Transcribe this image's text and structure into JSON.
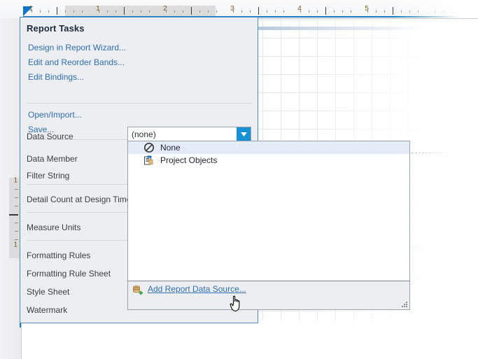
{
  "window": {
    "title": "Report Tasks"
  },
  "ruler": {
    "horizontal": {
      "unit_labels": [
        "1",
        "1",
        "2",
        "3",
        "4",
        "5"
      ],
      "marker_icon": "ruler-origin-marker"
    },
    "vertical": {
      "unit_labels": [
        "1",
        "1"
      ]
    }
  },
  "tasks_panel": {
    "title": "Report Tasks",
    "links": [
      {
        "label": "Design in Report Wizard...",
        "name": "design-in-report-wizard-link"
      },
      {
        "label": "Edit and Reorder Bands...",
        "name": "edit-and-reorder-bands-link"
      },
      {
        "label": "Edit Bindings...",
        "name": "edit-bindings-link"
      },
      {
        "label": "Open/Import...",
        "name": "open-import-link"
      },
      {
        "label": "Save...",
        "name": "save-link"
      }
    ],
    "properties": [
      {
        "label": "Data Source",
        "name": "property-data-source"
      },
      {
        "label": "Data Member",
        "name": "property-data-member"
      },
      {
        "label": "Filter String",
        "name": "property-filter-string"
      },
      {
        "label": "Detail Count at Design Time",
        "name": "property-detail-count-at-design-time"
      },
      {
        "label": "Measure Units",
        "name": "property-measure-units"
      },
      {
        "label": "Formatting Rules",
        "name": "property-formatting-rules"
      },
      {
        "label": "Formatting Rule Sheet",
        "name": "property-formatting-rule-sheet"
      },
      {
        "label": "Style Sheet",
        "name": "property-style-sheet"
      },
      {
        "label": "Watermark",
        "name": "property-watermark"
      }
    ]
  },
  "data_source_combo": {
    "value": "(none)",
    "arrow_icon": "chevron-down-icon"
  },
  "dropdown": {
    "items": [
      {
        "label": "None",
        "icon": "no-entry-icon",
        "selected": true
      },
      {
        "label": "Project Objects",
        "icon": "project-objects-icon",
        "selected": false
      }
    ],
    "footer": {
      "link_label": "Add Report Data Source...",
      "icon": "database-add-icon"
    },
    "resize_grip_icon": "resize-grip-icon"
  },
  "cursor": {
    "icon": "hand-pointer-cursor"
  },
  "colors": {
    "accent_blue": "#1790d4",
    "link_blue": "#2f6fb0",
    "panel_bg": "#edeef2",
    "panel_border": "#4a90c4",
    "selection_bg": "#e4edf7",
    "ruler_marker": "#0b75c9"
  }
}
